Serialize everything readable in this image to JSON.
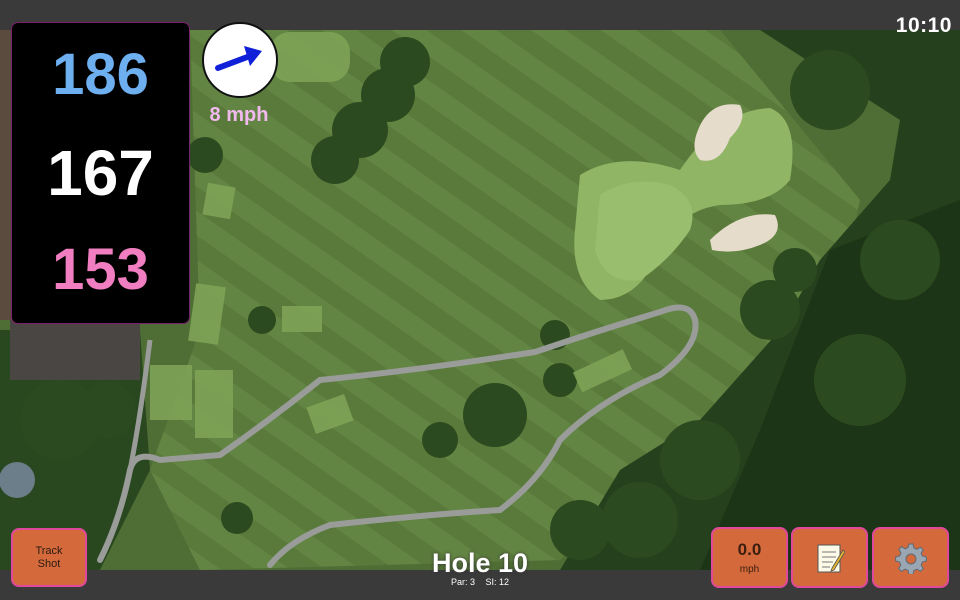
{
  "status": {
    "clock": "10:10"
  },
  "distances": {
    "back": "186",
    "middle": "167",
    "front": "153"
  },
  "wind": {
    "speed": "8 mph",
    "icon": "wind-direction-arrow-icon"
  },
  "hole": {
    "title": "Hole 10",
    "par": "Par: 3",
    "stroke_index": "SI: 12"
  },
  "buttons": {
    "track_shot_line1": "Track",
    "track_shot_line2": "Shot",
    "speed_value": "0.0",
    "speed_unit": "mph",
    "notes_icon": "notepad-icon",
    "settings_icon": "gear-icon"
  },
  "colors": {
    "back_distance": "#6eaff0",
    "middle_distance": "#ffffff",
    "front_distance": "#f07ec0",
    "button": "#d46a3c",
    "button_border": "#e0489c"
  }
}
